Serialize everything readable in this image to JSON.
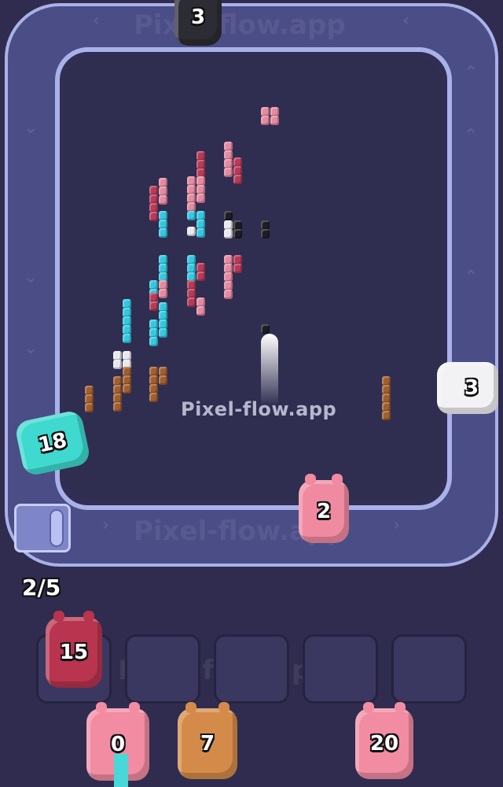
{
  "watermark": {
    "text": "Pixel-flow.app"
  },
  "conveyor": {
    "progress_text": "2/5"
  },
  "track_units": [
    {
      "id": "black-top",
      "number": "3",
      "color": "#2c2c34"
    },
    {
      "id": "white-right",
      "number": "3",
      "color": "#f2f2f5"
    },
    {
      "id": "cyan-left",
      "number": "18",
      "color": "#3fd9cf"
    },
    {
      "id": "pink-bottom",
      "number": "2",
      "color": "#f08aa0"
    }
  ],
  "queue_slots": [
    {
      "number": "15",
      "color": "#b8344f",
      "filled": true
    },
    {
      "filled": false
    },
    {
      "filled": false
    },
    {
      "filled": false
    },
    {
      "filled": false
    }
  ],
  "waiting_units": [
    {
      "number": "0",
      "color": "#f18ca3"
    },
    {
      "number": "7",
      "color": "#d48b4a"
    },
    {
      "number": "20",
      "color": "#f18ca3"
    }
  ],
  "colors": {
    "pink": "#e58aa0",
    "red": "#b83a58",
    "cyan": "#33c8e0",
    "white": "#e8e8ee",
    "black": "#1d1d24",
    "brown": "#a25e2d"
  }
}
